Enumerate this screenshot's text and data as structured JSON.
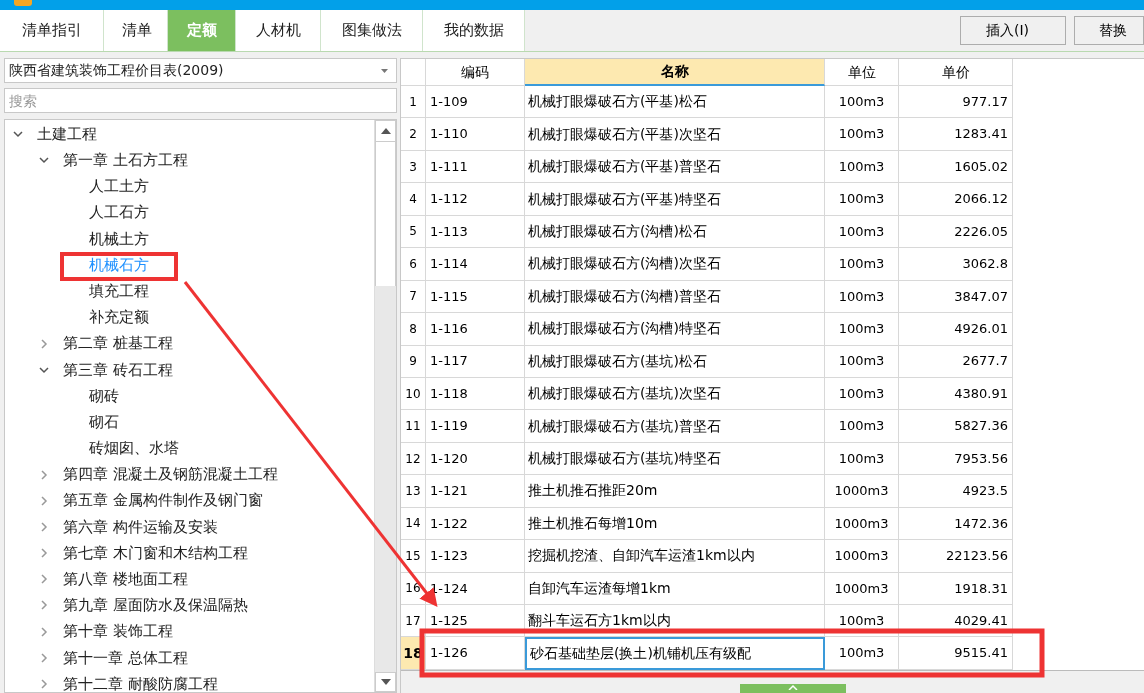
{
  "tabs": [
    {
      "label": "清单指引",
      "selected": false
    },
    {
      "label": "清单",
      "selected": false
    },
    {
      "label": "定额",
      "selected": true
    },
    {
      "label": "人材机",
      "selected": false
    },
    {
      "label": "图集做法",
      "selected": false
    },
    {
      "label": "我的数据",
      "selected": false
    }
  ],
  "toolbar_buttons": [
    "插入(I)",
    "替换"
  ],
  "library_select": {
    "value": "陕西省建筑装饰工程价目表(2009)"
  },
  "search": {
    "placeholder": "搜索"
  },
  "tree": [
    {
      "label": "土建工程",
      "expanded": true,
      "selected": false,
      "children": [
        {
          "label": "第一章 土石方工程",
          "expanded": true,
          "selected": false,
          "children": [
            {
              "label": "人工土方",
              "selected": false
            },
            {
              "label": "人工石方",
              "selected": false
            },
            {
              "label": "机械土方",
              "selected": false
            },
            {
              "label": "机械石方",
              "selected": true
            },
            {
              "label": "填充工程",
              "selected": false
            },
            {
              "label": "补充定额",
              "selected": false
            }
          ]
        },
        {
          "label": "第二章 桩基工程",
          "expanded": false,
          "selected": false
        },
        {
          "label": "第三章 砖石工程",
          "expanded": true,
          "selected": false,
          "children": [
            {
              "label": "砌砖",
              "selected": false
            },
            {
              "label": "砌石",
              "selected": false
            },
            {
              "label": "砖烟囱、水塔",
              "selected": false
            }
          ]
        },
        {
          "label": "第四章 混凝土及钢筋混凝土工程",
          "expanded": false,
          "selected": false
        },
        {
          "label": "第五章 金属构件制作及钢门窗",
          "expanded": false,
          "selected": false
        },
        {
          "label": "第六章 构件运输及安装",
          "expanded": false,
          "selected": false
        },
        {
          "label": "第七章 木门窗和木结构工程",
          "expanded": false,
          "selected": false
        },
        {
          "label": "第八章 楼地面工程",
          "expanded": false,
          "selected": false
        },
        {
          "label": "第九章 屋面防水及保温隔热",
          "expanded": false,
          "selected": false
        },
        {
          "label": "第十章 装饰工程",
          "expanded": false,
          "selected": false
        },
        {
          "label": "第十一章 总体工程",
          "expanded": false,
          "selected": false
        },
        {
          "label": "第十二章 耐酸防腐工程",
          "expanded": false,
          "selected": false
        }
      ]
    }
  ],
  "table": {
    "columns": [
      {
        "label": "编码",
        "selected": false
      },
      {
        "label": "名称",
        "selected": true
      },
      {
        "label": "单位",
        "selected": false
      },
      {
        "label": "单价",
        "selected": false
      }
    ],
    "rows": [
      {
        "no": "1",
        "code": "1-109",
        "name": "机械打眼爆破石方(平基)松石",
        "unit": "100m3",
        "price": "977.17",
        "selected": false
      },
      {
        "no": "2",
        "code": "1-110",
        "name": "机械打眼爆破石方(平基)次坚石",
        "unit": "100m3",
        "price": "1283.41",
        "selected": false
      },
      {
        "no": "3",
        "code": "1-111",
        "name": "机械打眼爆破石方(平基)普坚石",
        "unit": "100m3",
        "price": "1605.02",
        "selected": false
      },
      {
        "no": "4",
        "code": "1-112",
        "name": "机械打眼爆破石方(平基)特坚石",
        "unit": "100m3",
        "price": "2066.12",
        "selected": false
      },
      {
        "no": "5",
        "code": "1-113",
        "name": "机械打眼爆破石方(沟槽)松石",
        "unit": "100m3",
        "price": "2226.05",
        "selected": false
      },
      {
        "no": "6",
        "code": "1-114",
        "name": "机械打眼爆破石方(沟槽)次坚石",
        "unit": "100m3",
        "price": "3062.8",
        "selected": false
      },
      {
        "no": "7",
        "code": "1-115",
        "name": "机械打眼爆破石方(沟槽)普坚石",
        "unit": "100m3",
        "price": "3847.07",
        "selected": false
      },
      {
        "no": "8",
        "code": "1-116",
        "name": "机械打眼爆破石方(沟槽)特坚石",
        "unit": "100m3",
        "price": "4926.01",
        "selected": false
      },
      {
        "no": "9",
        "code": "1-117",
        "name": "机械打眼爆破石方(基坑)松石",
        "unit": "100m3",
        "price": "2677.7",
        "selected": false
      },
      {
        "no": "10",
        "code": "1-118",
        "name": "机械打眼爆破石方(基坑)次坚石",
        "unit": "100m3",
        "price": "4380.91",
        "selected": false
      },
      {
        "no": "11",
        "code": "1-119",
        "name": "机械打眼爆破石方(基坑)普坚石",
        "unit": "100m3",
        "price": "5827.36",
        "selected": false
      },
      {
        "no": "12",
        "code": "1-120",
        "name": "机械打眼爆破石方(基坑)特坚石",
        "unit": "100m3",
        "price": "7953.56",
        "selected": false
      },
      {
        "no": "13",
        "code": "1-121",
        "name": "推土机推石推距20m",
        "unit": "1000m3",
        "price": "4923.5",
        "selected": false
      },
      {
        "no": "14",
        "code": "1-122",
        "name": "推土机推石每增10m",
        "unit": "1000m3",
        "price": "1472.36",
        "selected": false
      },
      {
        "no": "15",
        "code": "1-123",
        "name": "挖掘机挖渣、自卸汽车运渣1km以内",
        "unit": "1000m3",
        "price": "22123.56",
        "selected": false
      },
      {
        "no": "16",
        "code": "1-124",
        "name": "自卸汽车运渣每增1km",
        "unit": "1000m3",
        "price": "1918.31",
        "selected": false
      },
      {
        "no": "17",
        "code": "1-125",
        "name": "翻斗车运石方1km以内",
        "unit": "100m3",
        "price": "4029.41",
        "selected": false
      },
      {
        "no": "18",
        "code": "1-126",
        "name": "砂石基础垫层(换土)机铺机压有级配",
        "unit": "100m3",
        "price": "9515.41",
        "selected": true
      }
    ]
  }
}
